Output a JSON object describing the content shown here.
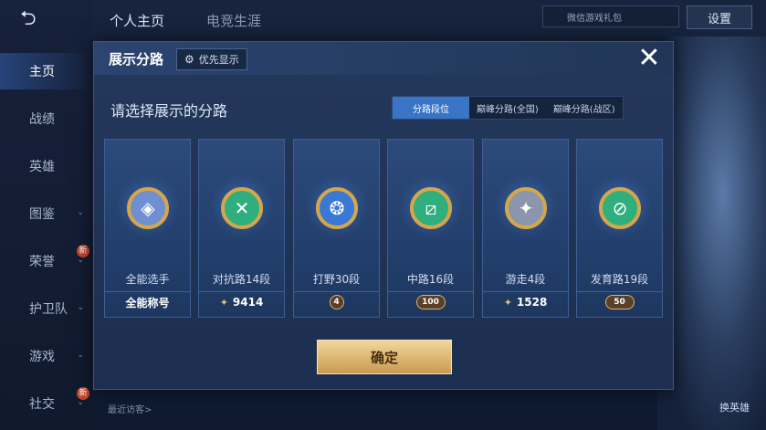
{
  "background": {
    "nav": [
      {
        "label": "主页",
        "active": true,
        "chevron": false,
        "badge": ""
      },
      {
        "label": "战绩",
        "active": false,
        "chevron": false,
        "badge": ""
      },
      {
        "label": "英雄",
        "active": false,
        "chevron": false,
        "badge": ""
      },
      {
        "label": "图鉴",
        "active": false,
        "chevron": true,
        "badge": ""
      },
      {
        "label": "荣誉",
        "active": false,
        "chevron": true,
        "badge": "新"
      },
      {
        "label": "护卫队",
        "active": false,
        "chevron": true,
        "badge": ""
      },
      {
        "label": "游戏",
        "active": false,
        "chevron": true,
        "badge": ""
      },
      {
        "label": "社交",
        "active": false,
        "chevron": true,
        "badge": "新"
      }
    ],
    "tab_profile": "个人主页",
    "tab_esports": "电竞生涯",
    "user_text": "微信游戏礼包",
    "settings": "设置",
    "recent_visitors": "最近访客>",
    "swap_hero": "换英雄"
  },
  "modal": {
    "title": "展示分路",
    "preference_button": "优先显示",
    "close_glyph": "✕",
    "subtitle": "请选择展示的分路",
    "tabs": [
      {
        "label": "分路段位",
        "active": true
      },
      {
        "label": "巅峰分路(全国)",
        "active": false
      },
      {
        "label": "巅峰分路(战区)",
        "active": false
      }
    ],
    "cards": [
      {
        "icon": "all-round-emblem-icon",
        "glyph": "◈",
        "color": "#6f8fd0",
        "rank": "全能选手",
        "score_type": "text",
        "score": "全能称号"
      },
      {
        "icon": "clash-lane-emblem-icon",
        "glyph": "✕",
        "color": "#2fae7e",
        "rank": "对抗路14段",
        "score_type": "points",
        "score": "9414"
      },
      {
        "icon": "jungle-emblem-icon",
        "glyph": "❂",
        "color": "#3a78d6",
        "rank": "打野30段",
        "score_type": "badge",
        "score": "4"
      },
      {
        "icon": "mid-lane-emblem-icon",
        "glyph": "⧄",
        "color": "#2fae7e",
        "rank": "中路16段",
        "score_type": "badge",
        "score": "100"
      },
      {
        "icon": "roam-emblem-icon",
        "glyph": "✦",
        "color": "#8a96ab",
        "rank": "游走4段",
        "score_type": "points",
        "score": "1528"
      },
      {
        "icon": "farm-lane-emblem-icon",
        "glyph": "⊘",
        "color": "#2fae7e",
        "rank": "发育路19段",
        "score_type": "badge",
        "score": "50"
      }
    ],
    "confirm": "确定"
  }
}
